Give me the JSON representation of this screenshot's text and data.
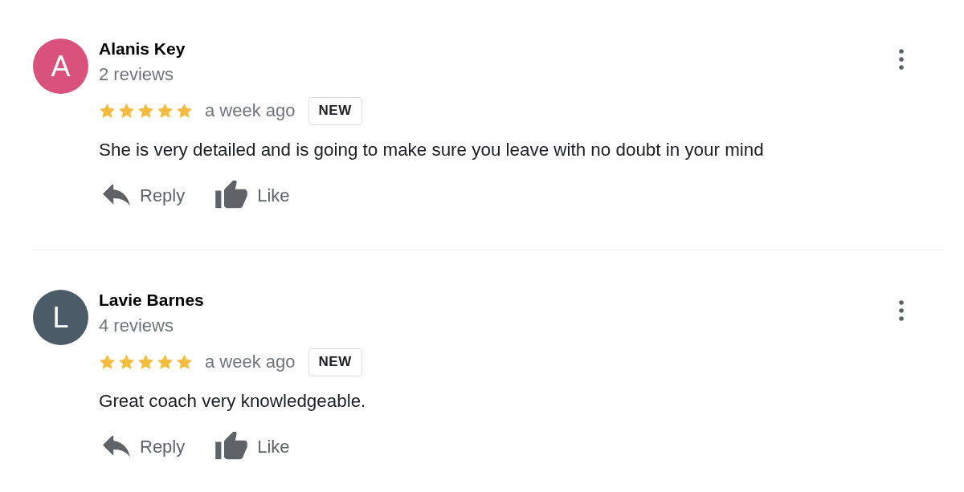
{
  "reviews": [
    {
      "avatar": {
        "letter": "A",
        "color": "#d9527c"
      },
      "name": "Alanis Key",
      "review_count": "2 reviews",
      "stars": 5,
      "time": "a week ago",
      "badge": "NEW",
      "text": "She is very detailed and is going to make sure you leave with no doubt in your mind",
      "actions": [
        {
          "kind": "reply",
          "label": "Reply"
        },
        {
          "kind": "like",
          "label": "Like"
        }
      ]
    },
    {
      "avatar": {
        "letter": "L",
        "color": "#4b5c68"
      },
      "name": "Lavie Barnes",
      "review_count": "4 reviews",
      "stars": 5,
      "time": "a week ago",
      "badge": "NEW",
      "text": "Great coach very knowledgeable.",
      "actions": [
        {
          "kind": "reply",
          "label": "Reply"
        },
        {
          "kind": "like",
          "label": "Like"
        }
      ]
    }
  ]
}
